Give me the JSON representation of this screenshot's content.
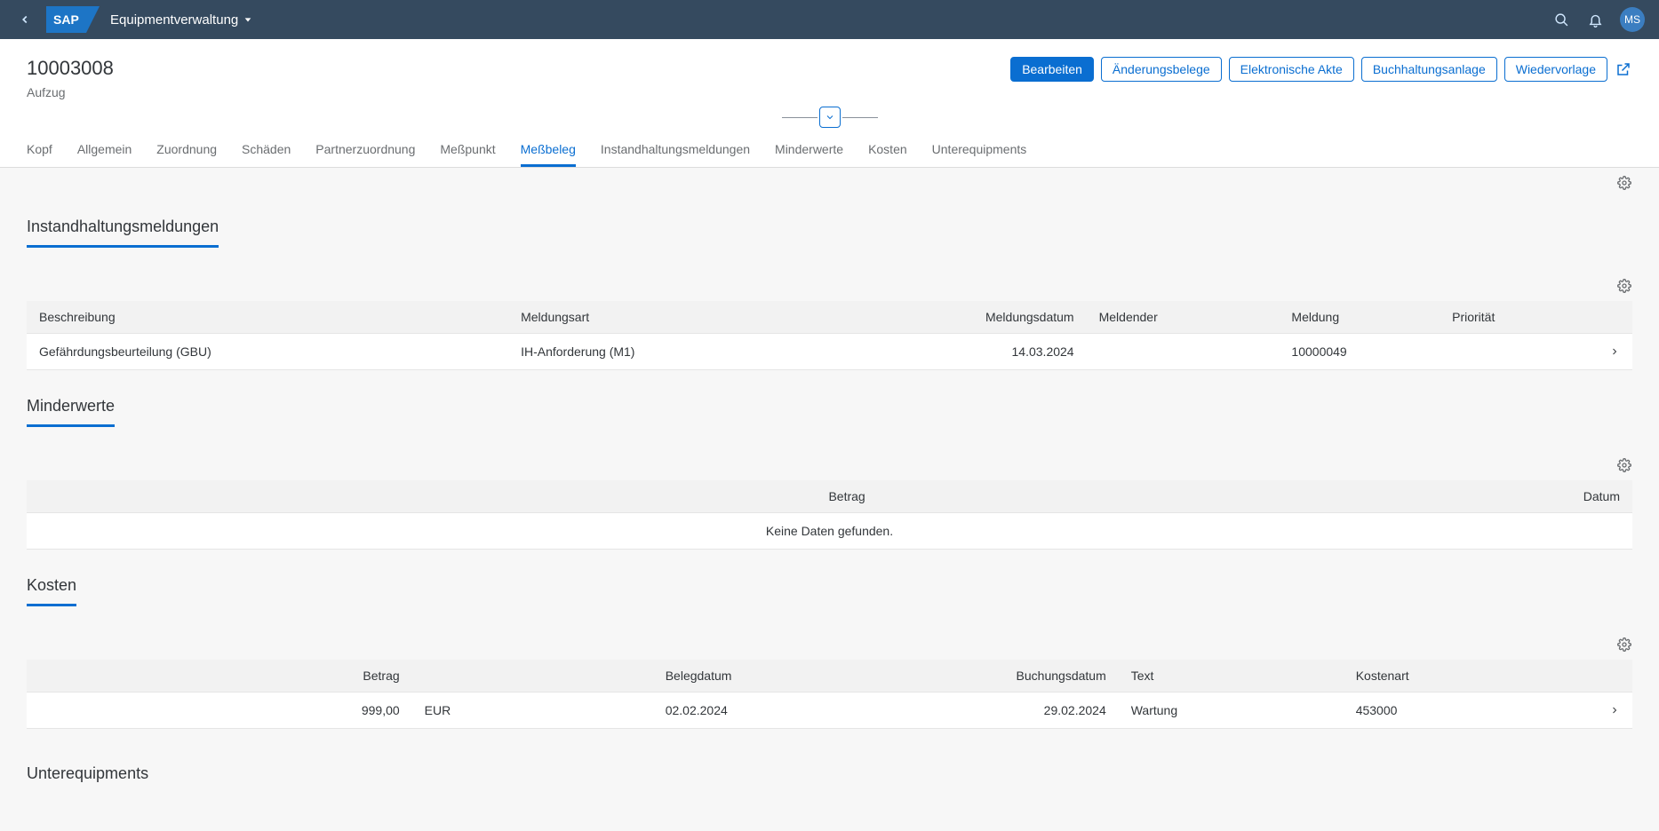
{
  "shell": {
    "app_title": "Equipmentverwaltung",
    "avatar": "MS"
  },
  "header": {
    "title": "10003008",
    "subtitle": "Aufzug",
    "actions": {
      "edit": "Bearbeiten",
      "changes": "Änderungsbelege",
      "efile": "Elektronische Akte",
      "accounting": "Buchhaltungsanlage",
      "resub": "Wiedervorlage"
    }
  },
  "tabs": [
    "Kopf",
    "Allgemein",
    "Zuordnung",
    "Schäden",
    "Partnerzuordnung",
    "Meßpunkt",
    "Meßbeleg",
    "Instandhaltungsmeldungen",
    "Minderwerte",
    "Kosten",
    "Unterequipments"
  ],
  "active_tab_index": 6,
  "sections": {
    "notifications": {
      "title": "Instandhaltungsmeldungen",
      "columns": {
        "desc": "Beschreibung",
        "type": "Meldungsart",
        "date": "Meldungsdatum",
        "reporter": "Meldender",
        "id": "Meldung",
        "prio": "Priorität"
      },
      "rows": [
        {
          "desc": "Gefährdungsbeurteilung (GBU)",
          "type": "IH-Anforderung (M1)",
          "date": "14.03.2024",
          "reporter": "",
          "id": "10000049",
          "prio": ""
        }
      ]
    },
    "minderwerte": {
      "title": "Minderwerte",
      "columns": {
        "betrag": "Betrag",
        "datum": "Datum"
      },
      "nodata": "Keine Daten gefunden."
    },
    "kosten": {
      "title": "Kosten",
      "columns": {
        "betrag": "Betrag",
        "currency": "",
        "belegdatum": "Belegdatum",
        "buchung": "Buchungsdatum",
        "text": "Text",
        "kostenart": "Kostenart"
      },
      "rows": [
        {
          "betrag": "999,00",
          "currency": "EUR",
          "belegdatum": "02.02.2024",
          "buchung": "29.02.2024",
          "text": "Wartung",
          "kostenart": "453000"
        }
      ]
    },
    "unterequipments": {
      "title": "Unterequipments"
    }
  }
}
